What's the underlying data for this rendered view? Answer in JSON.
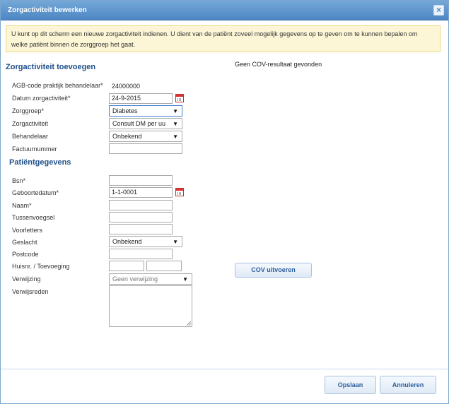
{
  "window": {
    "title": "Zorgactiviteit bewerken",
    "close_glyph": "×"
  },
  "notice": "U kunt op dit scherm een nieuwe zorgactiviteit indienen. U dient van de patiënt zoveel mogelijk gegevens op te geven om te kunnen bepalen om welke patiënt binnen de zorggroep het gaat.",
  "section_activity": {
    "title": "Zorgactiviteit toevoegen",
    "agb_label": "AGB-code praktijk behandelaar*",
    "agb_value": "24000000",
    "date_label": "Datum zorgactiviteit*",
    "date_value": "24-9-2015",
    "group_label": "Zorggroep*",
    "group_value": "Diabetes",
    "activity_label": "Zorgactiviteit",
    "activity_value": "Consult DM per uu",
    "practitioner_label": "Behandelaar",
    "practitioner_value": "Onbekend",
    "invoice_label": "Factuurnummer",
    "invoice_value": ""
  },
  "status": {
    "cov_result": "Geen COV-resultaat gevonden"
  },
  "section_patient": {
    "title": "Patiëntgegevens",
    "bsn_label": "Bsn*",
    "bsn_value": "",
    "birthdate_label": "Geboortedatum*",
    "birthdate_value": "1-1-0001",
    "name_label": "Naam*",
    "name_value": "",
    "infix_label": "Tussenvoegsel",
    "infix_value": "",
    "initials_label": "Voorletters",
    "initials_value": "",
    "gender_label": "Geslacht",
    "gender_value": "Onbekend",
    "postcode_label": "Postcode",
    "postcode_value": "",
    "housenr_label": "Huisnr. / Toevoeging",
    "housenr_value": "",
    "addition_value": "",
    "referral_label": "Verwijzing",
    "referral_value": "Geen verwijzing",
    "referral_reason_label": "Verwijsreden",
    "referral_reason_value": ""
  },
  "buttons": {
    "cov": "COV uitvoeren",
    "save": "Opslaan",
    "cancel": "Annuleren"
  },
  "icons": {
    "calendar": "calendar-icon",
    "dropdown": "▼"
  },
  "colors": {
    "title_bar": "#4d86c3",
    "section_title": "#1f4f8a",
    "notice_bg": "#fdf6d6"
  }
}
